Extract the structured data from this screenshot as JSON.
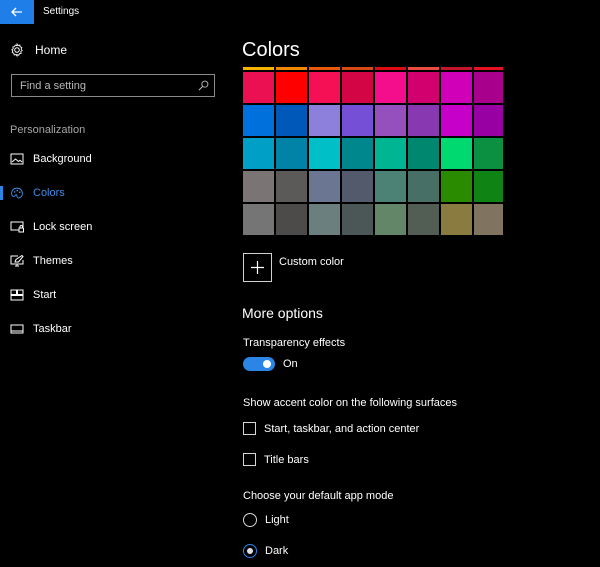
{
  "titlebar": {
    "title": "Settings",
    "back_icon": "back-arrow-icon",
    "accent": "#1f7ee8"
  },
  "sidebar": {
    "home_label": "Home",
    "search_placeholder": "Find a setting",
    "section_label": "Personalization",
    "items": [
      {
        "label": "Background",
        "icon": "picture-icon",
        "active": false
      },
      {
        "label": "Colors",
        "icon": "palette-icon",
        "active": true
      },
      {
        "label": "Lock screen",
        "icon": "lock-screen-icon",
        "active": false
      },
      {
        "label": "Themes",
        "icon": "themes-icon",
        "active": false
      },
      {
        "label": "Start",
        "icon": "start-icon",
        "active": false
      },
      {
        "label": "Taskbar",
        "icon": "taskbar-icon",
        "active": false
      }
    ]
  },
  "main": {
    "title": "Colors",
    "swatches": [
      [
        "#f7b200",
        "#f08800",
        "#e85a0a",
        "#d74a12",
        "#dc0c15",
        "#ea4c3f",
        "#c5152b",
        "#e81123"
      ],
      [
        "#ea1051",
        "#ff0000",
        "#f50f55",
        "#d40545",
        "#f50e8b",
        "#d2006e",
        "#d000b8",
        "#a8008c"
      ],
      [
        "#0070dc",
        "#0058b8",
        "#8d80dd",
        "#7550d6",
        "#9550bd",
        "#8838b0",
        "#c600c8",
        "#9800a4"
      ],
      [
        "#009fc6",
        "#0083a6",
        "#00bfc6",
        "#00878d",
        "#00b592",
        "#00876f",
        "#00d870",
        "#0a9040"
      ],
      [
        "#7a7574",
        "#5c5a59",
        "#6b7792",
        "#535a6c",
        "#4c8276",
        "#476f65",
        "#2a8b00",
        "#0f8414"
      ],
      [
        "#757575",
        "#4c4b4a",
        "#6b7f7e",
        "#4b5657",
        "#638669",
        "#525e54",
        "#8a7b40",
        "#807360"
      ]
    ],
    "custom_color_label": "Custom color",
    "more_options_title": "More options",
    "transparency": {
      "label": "Transparency effects",
      "state_label": "On",
      "on": true
    },
    "accent_surfaces": {
      "label": "Show accent color on the following surfaces",
      "options": [
        {
          "label": "Start, taskbar, and action center",
          "checked": false
        },
        {
          "label": "Title bars",
          "checked": false
        }
      ]
    },
    "app_mode": {
      "label": "Choose your default app mode",
      "options": [
        {
          "label": "Light",
          "selected": false
        },
        {
          "label": "Dark",
          "selected": true
        }
      ]
    }
  }
}
